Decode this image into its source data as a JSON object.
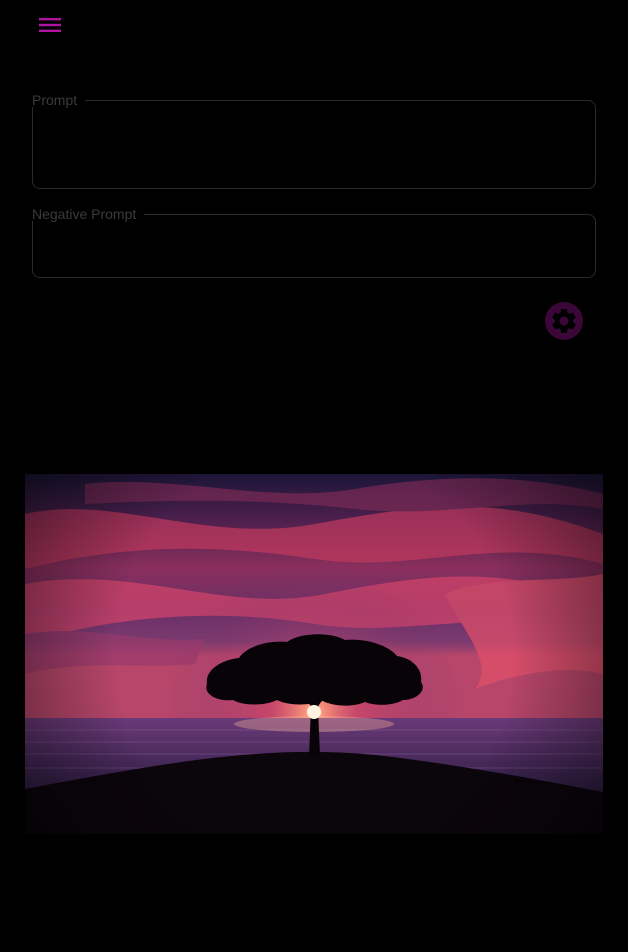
{
  "colors": {
    "background": "#000000",
    "accent": "#b0139f",
    "field_border": "#2b2b2b",
    "label": "#3a3a3a"
  },
  "header": {
    "menu_icon": "menu-icon"
  },
  "form": {
    "prompt": {
      "label": "Prompt",
      "value": ""
    },
    "negative_prompt": {
      "label": "Negative Prompt",
      "value": ""
    },
    "settings_icon": "gear-icon"
  },
  "result": {
    "image_subject": "tree-silhouette-sunset-over-sea"
  }
}
